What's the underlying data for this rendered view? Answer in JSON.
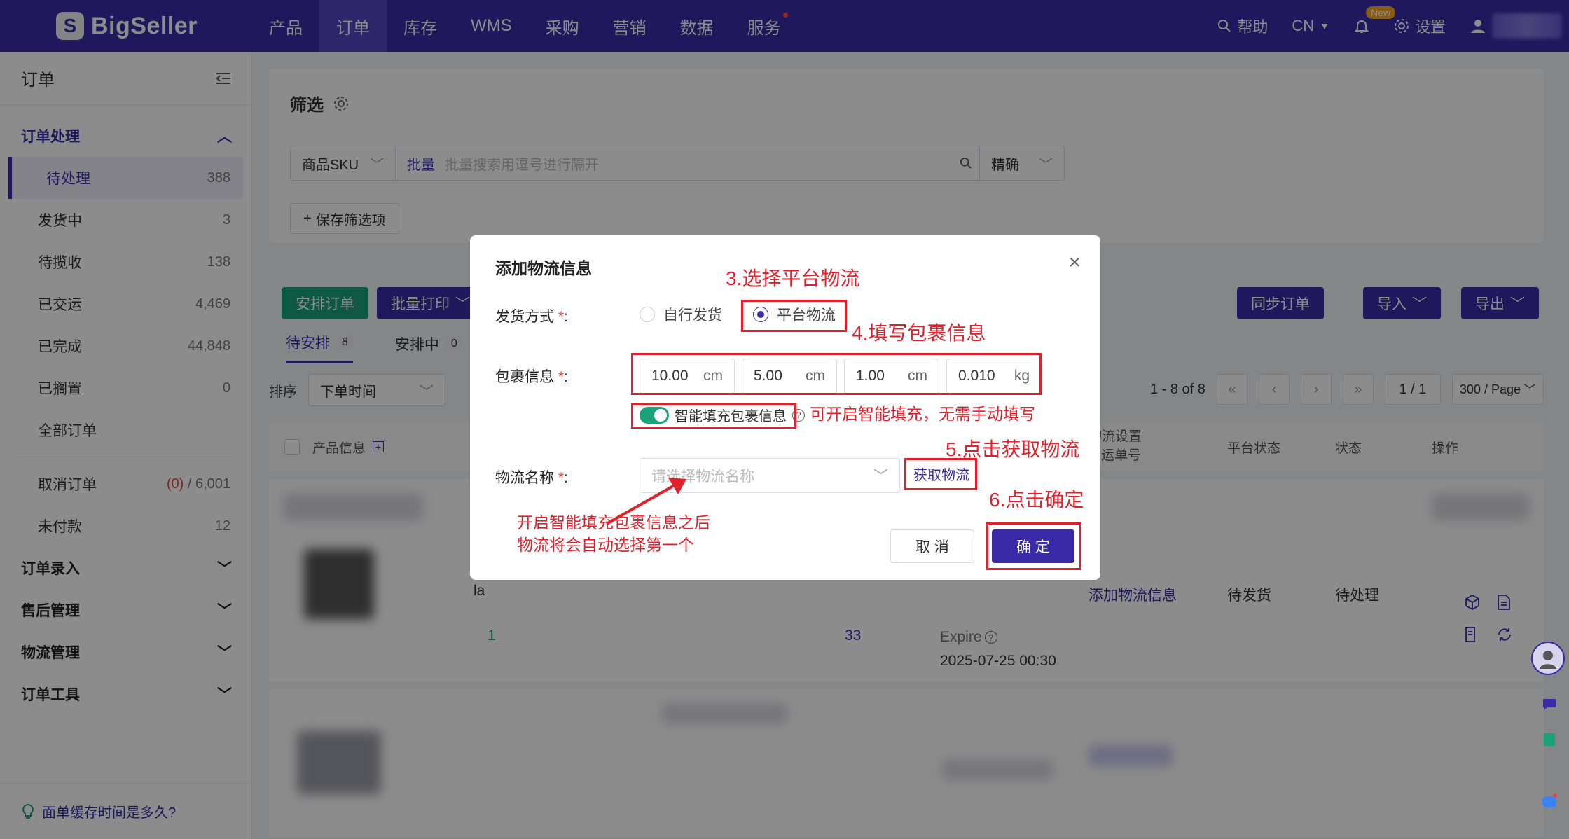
{
  "brand": {
    "name": "BigSeller",
    "accent": "#3b2aa8",
    "green": "#1aa37a",
    "annotation_red": "#e0202a"
  },
  "nav": {
    "items": [
      "产品",
      "订单",
      "库存",
      "WMS",
      "采购",
      "营销",
      "数据",
      "服务"
    ],
    "active": "订单",
    "help": "帮助",
    "lang": "CN",
    "new_badge": "New",
    "settings": "设置"
  },
  "sidebar": {
    "title": "订单",
    "group_order_processing": "订单处理",
    "items": [
      {
        "label": "待处理",
        "count": "388"
      },
      {
        "label": "发货中",
        "count": "3"
      },
      {
        "label": "待揽收",
        "count": "138"
      },
      {
        "label": "已交运",
        "count": "4,469"
      },
      {
        "label": "已完成",
        "count": "44,848"
      },
      {
        "label": "已搁置",
        "count": "0"
      },
      {
        "label": "全部订单",
        "count": ""
      }
    ],
    "cancel": {
      "label": "取消订单",
      "red": "(0)",
      "total": "/ 6,001"
    },
    "unpaid": {
      "label": "未付款",
      "count": "12"
    },
    "groups": [
      "订单录入",
      "售后管理",
      "物流管理",
      "订单工具"
    ],
    "footer": "面单缓存时间是多久?"
  },
  "filter": {
    "title": "筛选",
    "field_select": "商品SKU",
    "batch_label": "批量",
    "placeholder": "批量搜索用逗号进行隔开",
    "mode": "精确",
    "save": "保存筛选项"
  },
  "actions": {
    "arrange": "安排订单",
    "batch_print": "批量打印",
    "sync": "同步订单",
    "import": "导入",
    "export": "导出"
  },
  "tabs": [
    {
      "label": "待安排",
      "count": "8"
    },
    {
      "label": "安排中",
      "count": "0"
    }
  ],
  "sort": {
    "label": "排序",
    "value": "下单时间"
  },
  "pager": {
    "range": "1 - 8 of 8",
    "page": "1 / 1",
    "size": "300 / Page"
  },
  "table": {
    "headers": {
      "product": "产品信息",
      "logistics": "物流设置\n& 运单号",
      "platform_status": "平台状态",
      "status": "状态",
      "ops": "操作"
    },
    "row": {
      "qty": "1",
      "num": "33",
      "expire": "Expire",
      "time": "2025-07-25 00:30",
      "add_logistics": "添加物流信息",
      "platform_status": "待发货",
      "status": "待处理",
      "la_text": "la"
    }
  },
  "modal": {
    "title": "添加物流信息",
    "ship_method_label": "发货方式",
    "option_self": "自行发货",
    "option_platform": "平台物流",
    "package_label": "包裹信息",
    "length": "10.00",
    "width": "5.00",
    "height": "1.00",
    "weight": "0.010",
    "unit_cm": "cm",
    "unit_kg": "kg",
    "smart_fill": "智能填充包裹信息",
    "logistics_label": "物流名称",
    "logistics_placeholder": "请选择物流名称",
    "get_logistics": "获取物流",
    "cancel": "取 消",
    "confirm": "确 定"
  },
  "annotations": {
    "step3": "3.选择平台物流",
    "step4": "4.填写包裹信息",
    "smart_note": "可开启智能填充，无需手动填写",
    "step5": "5.点击获取物流",
    "step6": "6.点击确定",
    "auto_note_1": "开启智能填充包裹信息之后",
    "auto_note_2": "物流将会自动选择第一个"
  }
}
